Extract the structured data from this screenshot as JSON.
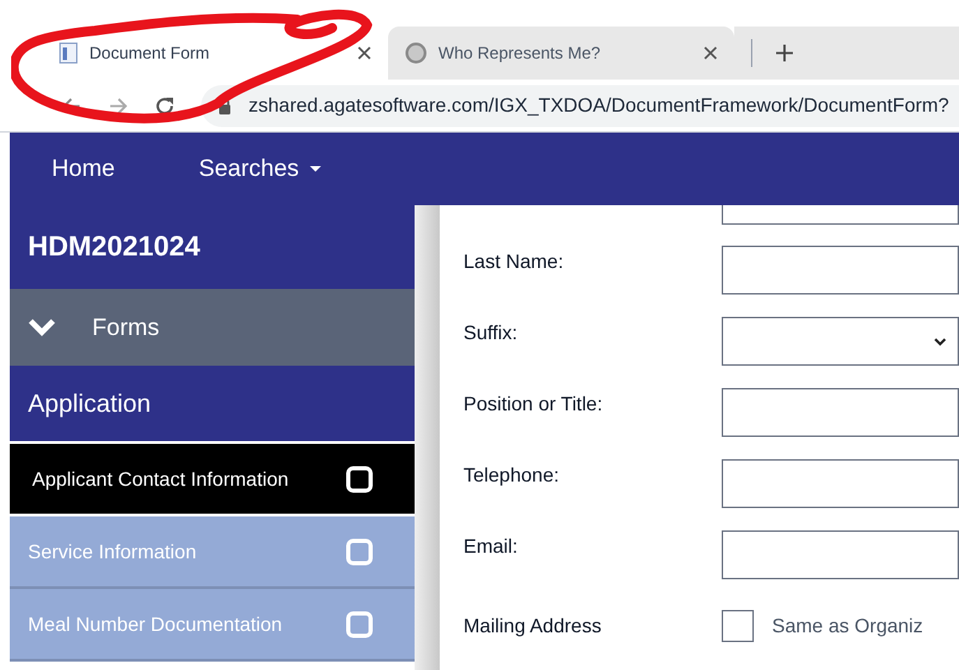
{
  "browser": {
    "tabs": [
      {
        "title": "Document Form",
        "selected": true
      },
      {
        "title": "Who Represents Me?",
        "selected": false
      }
    ],
    "url": "zshared.agatesoftware.com/IGX_TXDOA/DocumentFramework/DocumentForm?"
  },
  "nav": [
    "Home",
    "Searches"
  ],
  "sidebar": {
    "title": "HDM2021024",
    "section": {
      "label": "Forms",
      "expanded": true
    },
    "group": "Application",
    "items": [
      {
        "label": "Applicant Contact Information",
        "selected": true,
        "checked": false
      },
      {
        "label": "Service Information",
        "selected": false,
        "checked": false
      },
      {
        "label": "Meal Number Documentation",
        "selected": false,
        "checked": false
      }
    ]
  },
  "form": {
    "fields": [
      {
        "kind": "text"
      },
      {
        "kind": "text",
        "label": "Last Name:"
      },
      {
        "kind": "select",
        "label": "Suffix:"
      },
      {
        "kind": "text",
        "label": "Position or Title:"
      },
      {
        "kind": "text",
        "label": "Telephone:"
      },
      {
        "kind": "text",
        "label": "Email:"
      },
      {
        "kind": "checkbox",
        "label": "Mailing Address",
        "option": "Same as Organiz",
        "checked": false
      }
    ]
  }
}
